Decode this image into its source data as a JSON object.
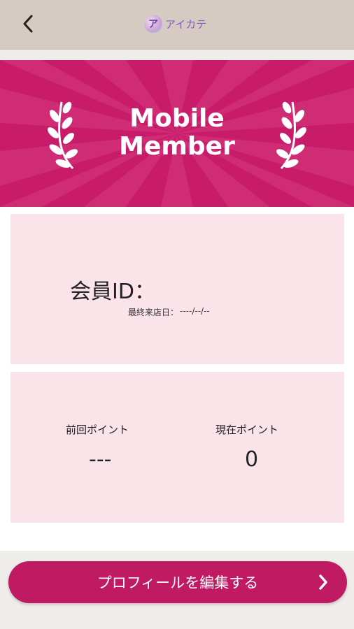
{
  "header": {
    "back_icon": "chevron-left-icon",
    "logo_text": "アイカテ"
  },
  "hero": {
    "title_line1": "Mobile",
    "title_line2": "Member"
  },
  "member": {
    "id_label": "会員ID：",
    "last_visit_label": "最終来店日：",
    "last_visit_value": "----/--/--"
  },
  "points": {
    "previous_label": "前回ポイント",
    "previous_value": "---",
    "current_label": "現在ポイント",
    "current_value": "0"
  },
  "cta": {
    "label": "プロフィールを編集する",
    "arrow_icon": "chevron-right-icon"
  },
  "colors": {
    "primary": "#c81b6a",
    "card_bg": "#fbe3ea",
    "header_bg": "#d6cbc2"
  }
}
